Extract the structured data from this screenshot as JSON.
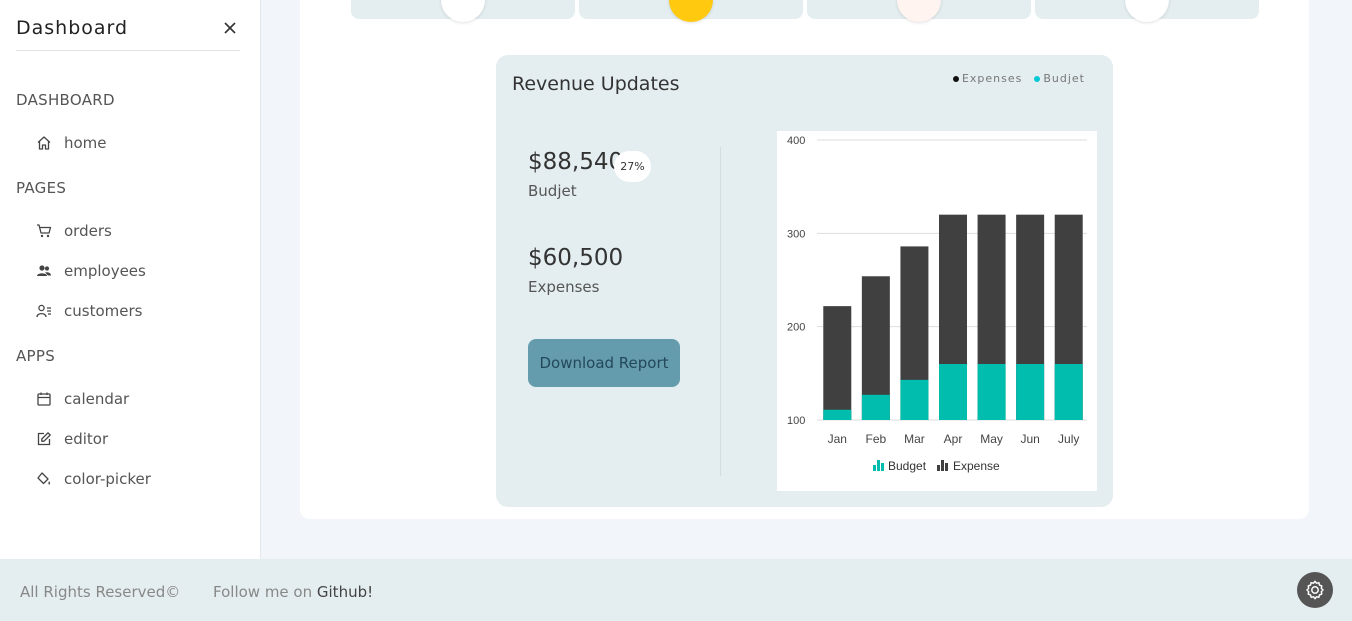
{
  "sidebar": {
    "title": "Dashboard",
    "sections": [
      {
        "label": "DASHBOARD",
        "items": [
          {
            "label": "home",
            "icon": "home-icon"
          }
        ]
      },
      {
        "label": "PAGES",
        "items": [
          {
            "label": "orders",
            "icon": "cart-icon"
          },
          {
            "label": "employees",
            "icon": "users-icon"
          },
          {
            "label": "customers",
            "icon": "user-list-icon"
          }
        ]
      },
      {
        "label": "APPS",
        "items": [
          {
            "label": "calendar",
            "icon": "calendar-icon"
          },
          {
            "label": "editor",
            "icon": "edit-icon"
          },
          {
            "label": "color-picker",
            "icon": "paint-bucket-icon"
          }
        ]
      }
    ]
  },
  "revenue": {
    "title": "Revenue Updates",
    "legend": {
      "expenses": "Expenses",
      "budget": "Budjet"
    },
    "budget_amount": "$88,540",
    "budget_pct": "27%",
    "budget_label": "Budjet",
    "expenses_amount": "$60,500",
    "expenses_label": "Expenses",
    "download_label": "Download Report"
  },
  "chart_data": {
    "type": "bar",
    "stacked": true,
    "categories": [
      "Jan",
      "Feb",
      "Mar",
      "Apr",
      "May",
      "Jun",
      "July"
    ],
    "series": [
      {
        "name": "Budget",
        "color": "#00bdae",
        "values": [
          111,
          127,
          143,
          160,
          160,
          160,
          160
        ]
      },
      {
        "name": "Expense",
        "color": "#404041",
        "values": [
          222,
          254,
          286,
          320,
          320,
          320,
          320
        ]
      }
    ],
    "ylim": [
      100,
      400
    ],
    "yticks": [
      100,
      200,
      300,
      400
    ],
    "grid": true,
    "legend_position": "bottom"
  },
  "footer": {
    "rights": "All Rights Reserved©",
    "follow_prefix": "Follow me on ",
    "follow_link": "Github!"
  },
  "colors": {
    "budget": "#00bdae",
    "expense": "#404041",
    "accent": "#649cae"
  }
}
